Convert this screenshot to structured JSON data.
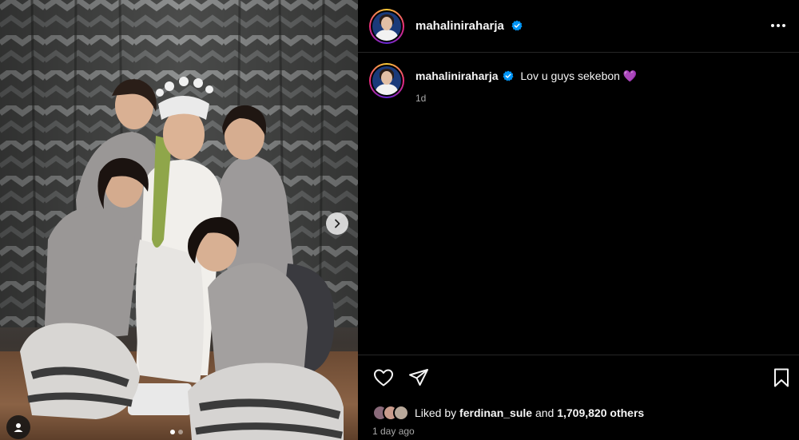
{
  "post": {
    "username": "mahaliniraharja",
    "caption_user": "mahaliniraharja",
    "caption_text": "Lov u guys sekebon 💜",
    "caption_age": "1d",
    "liked_by_prefix": "Liked by",
    "liked_by_user": "ferdinan_sule",
    "liked_by_and": "and",
    "liked_by_others": "1,709,820 others",
    "posted_time": "1 day ago"
  },
  "carousel": {
    "current_index": 1,
    "total": 2
  },
  "icons": {
    "verified": "verified-badge-icon",
    "more": "more-options-icon",
    "like": "heart-icon",
    "share": "share-icon",
    "save": "bookmark-icon",
    "next": "chevron-right-icon",
    "tag": "user-tag-icon"
  },
  "colors": {
    "background": "#000000",
    "text": "#f5f5f5",
    "muted": "#a8a8a8",
    "verified": "#0095f6",
    "divider": "#262626"
  }
}
